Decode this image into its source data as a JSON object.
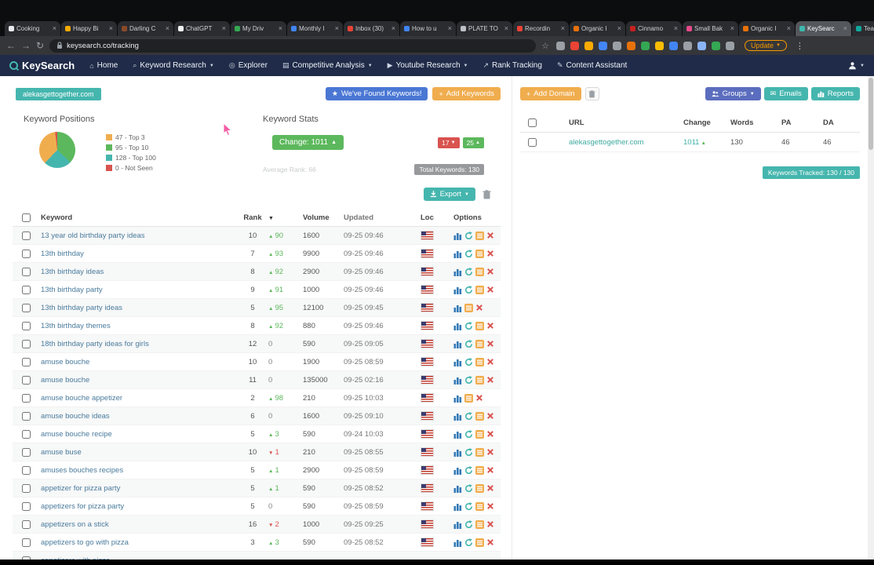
{
  "browser": {
    "tabs": [
      {
        "title": "Cooking",
        "favicon": "#e8eaed"
      },
      {
        "title": "Happy Bi",
        "favicon": "#f9ab00"
      },
      {
        "title": "Darling C",
        "favicon": "#8a4a2a"
      },
      {
        "title": "ChatGPT",
        "favicon": "#f2f2f2"
      },
      {
        "title": "My Driv",
        "favicon": "#34a853"
      },
      {
        "title": "Monthly I",
        "favicon": "#4285f4"
      },
      {
        "title": "Inbox (30)",
        "favicon": "#ea4335"
      },
      {
        "title": "How to u",
        "favicon": "#4285f4"
      },
      {
        "title": "PLATE TO",
        "favicon": "#bdc1c6"
      },
      {
        "title": "Recordin",
        "favicon": "#ea4335"
      },
      {
        "title": "Organic I",
        "favicon": "#e8710a"
      },
      {
        "title": "Cinnamo",
        "favicon": "#c5221f"
      },
      {
        "title": "Small Bak",
        "favicon": "#e84a8a"
      },
      {
        "title": "Organic I",
        "favicon": "#e8710a"
      },
      {
        "title": "KeySearc",
        "favicon": "#3fb6ae",
        "active": true
      },
      {
        "title": "Teachabl",
        "favicon": "#12a79d"
      }
    ],
    "url": "keysearch.co/tracking",
    "update_label": "Update",
    "extension_icon_colors": [
      "#9aa0a6",
      "#ea4335",
      "#f9ab00",
      "#4285f4",
      "#9aa0a6",
      "#e8710a",
      "#34a853",
      "#fbbc04",
      "#4285f4",
      "#9aa0a6",
      "#8ab4f8",
      "#34a853",
      "#9aa0a6"
    ]
  },
  "nav": {
    "brand": "KeySearch",
    "items": [
      {
        "label": "Home",
        "icon": "home-icon",
        "caret": false
      },
      {
        "label": "Keyword Research",
        "icon": "search-icon",
        "caret": true
      },
      {
        "label": "Explorer",
        "icon": "compass-icon",
        "caret": false
      },
      {
        "label": "Competitive Analysis",
        "icon": "chart-icon",
        "caret": true
      },
      {
        "label": "Youtube Research",
        "icon": "youtube-icon",
        "caret": true
      },
      {
        "label": "Rank Tracking",
        "icon": "rank-icon",
        "caret": false
      },
      {
        "label": "Content Assistant",
        "icon": "content-icon",
        "caret": false
      }
    ]
  },
  "overview": {
    "domain_badge": "alekasgettogether.com",
    "found_keywords_button": "We've Found Keywords!",
    "add_keywords_button": "Add Keywords",
    "positions": {
      "title": "Keyword Positions",
      "legend": [
        {
          "label": "47 - Top 3",
          "color": "#f0ad4e",
          "value": 47
        },
        {
          "label": "95 - Top 10",
          "color": "#5cb85c",
          "value": 95
        },
        {
          "label": "128 - Top 100",
          "color": "#45b6ae",
          "value": 128
        },
        {
          "label": "0 - Not Seen",
          "color": "#d9534f",
          "value": 0
        }
      ]
    },
    "stats": {
      "title": "Keyword Stats",
      "change_label": "Change: 1011",
      "down_badge": "17",
      "up_badge": "25",
      "average_rank": "Average Rank: 66",
      "total_keywords": "Total Keywords: 130"
    }
  },
  "domains_panel": {
    "add_domain_button": "Add Domain",
    "groups_button": "Groups",
    "emails_button": "Emails",
    "reports_button": "Reports",
    "headers": [
      "URL",
      "Change",
      "Words",
      "PA",
      "DA"
    ],
    "rows": [
      {
        "url": "alekasgettogether.com",
        "change": "1011",
        "words": "130",
        "pa": "46",
        "da": "46"
      }
    ],
    "keywords_tracked": "Keywords Tracked: 130 / 130"
  },
  "keywords": {
    "export_button": "Export",
    "headers": {
      "keyword": "Keyword",
      "rank": "Rank",
      "volume": "Volume",
      "updated": "Updated",
      "loc": "Loc",
      "options": "Options"
    },
    "rows": [
      {
        "keyword": "13 year old birthday party ideas",
        "rank": "10",
        "dir": "up",
        "change": "90",
        "volume": "1600",
        "updated": "09-25 09:46",
        "refresh": true
      },
      {
        "keyword": "13th birthday",
        "rank": "7",
        "dir": "up",
        "change": "93",
        "volume": "9900",
        "updated": "09-25 09:46",
        "refresh": true
      },
      {
        "keyword": "13th birthday ideas",
        "rank": "8",
        "dir": "up",
        "change": "92",
        "volume": "2900",
        "updated": "09-25 09:46",
        "refresh": true
      },
      {
        "keyword": "13th birthday party",
        "rank": "9",
        "dir": "up",
        "change": "91",
        "volume": "1000",
        "updated": "09-25 09:46",
        "refresh": true
      },
      {
        "keyword": "13th birthday party ideas",
        "rank": "5",
        "dir": "up",
        "change": "95",
        "volume": "12100",
        "updated": "09-25 09:45",
        "refresh": false
      },
      {
        "keyword": "13th birthday themes",
        "rank": "8",
        "dir": "up",
        "change": "92",
        "volume": "880",
        "updated": "09-25 09:46",
        "refresh": true
      },
      {
        "keyword": "18th birthday party ideas for girls",
        "rank": "12",
        "dir": "zero",
        "change": "0",
        "volume": "590",
        "updated": "09-25 09:05",
        "refresh": true
      },
      {
        "keyword": "amuse bouche",
        "rank": "10",
        "dir": "zero",
        "change": "0",
        "volume": "1900",
        "updated": "09-25 08:59",
        "refresh": true
      },
      {
        "keyword": "amuse bouche",
        "rank": "11",
        "dir": "zero",
        "change": "0",
        "volume": "135000",
        "updated": "09-25 02:16",
        "refresh": true
      },
      {
        "keyword": "amuse bouche appetizer",
        "rank": "2",
        "dir": "up",
        "change": "98",
        "volume": "210",
        "updated": "09-25 10:03",
        "refresh": false
      },
      {
        "keyword": "amuse bouche ideas",
        "rank": "6",
        "dir": "zero",
        "change": "0",
        "volume": "1600",
        "updated": "09-25 09:10",
        "refresh": true
      },
      {
        "keyword": "amuse bouche recipe",
        "rank": "5",
        "dir": "up",
        "change": "3",
        "volume": "590",
        "updated": "09-24 10:03",
        "refresh": true
      },
      {
        "keyword": "amuse buse",
        "rank": "10",
        "dir": "down",
        "change": "1",
        "volume": "210",
        "updated": "09-25 08:55",
        "refresh": true
      },
      {
        "keyword": "amuses bouches recipes",
        "rank": "5",
        "dir": "up",
        "change": "1",
        "volume": "2900",
        "updated": "09-25 08:59",
        "refresh": true
      },
      {
        "keyword": "appetizer for pizza party",
        "rank": "5",
        "dir": "up",
        "change": "1",
        "volume": "590",
        "updated": "09-25 08:52",
        "refresh": true
      },
      {
        "keyword": "appetizers for pizza party",
        "rank": "5",
        "dir": "zero",
        "change": "0",
        "volume": "590",
        "updated": "09-25 08:59",
        "refresh": true
      },
      {
        "keyword": "appetizers on a stick",
        "rank": "16",
        "dir": "down",
        "change": "2",
        "volume": "1000",
        "updated": "09-25 09:25",
        "refresh": true
      },
      {
        "keyword": "appetizers to go with pizza",
        "rank": "3",
        "dir": "up",
        "change": "3",
        "volume": "590",
        "updated": "09-25 08:52",
        "refresh": true
      },
      {
        "keyword": "appetizers with pizza",
        "rank": "",
        "dir": "zero",
        "change": "",
        "volume": "",
        "updated": "",
        "refresh": false,
        "partial": true
      }
    ]
  }
}
